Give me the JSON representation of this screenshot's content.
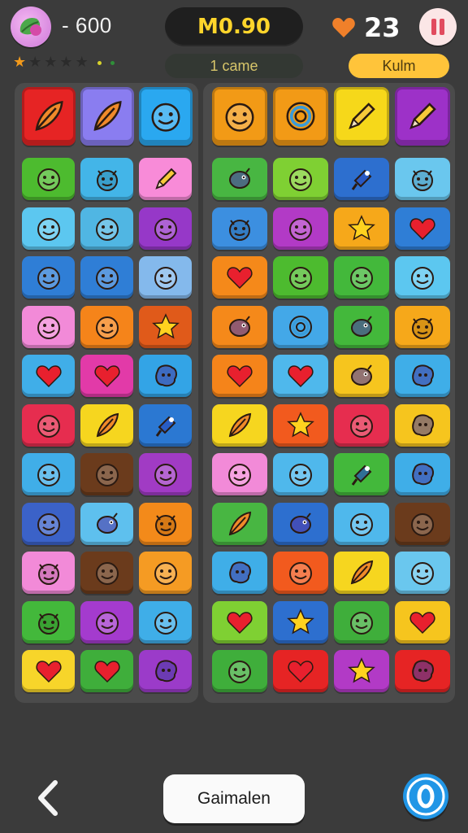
{
  "hud": {
    "coins": "- 600",
    "score": "M0.90",
    "subtitle": "1 came",
    "lives": "23",
    "mode": "Kulm"
  },
  "rating": {
    "stars": [
      {
        "color": "#f39a1b"
      },
      {
        "color": "#2b2b2b"
      },
      {
        "color": "#2b2b2b"
      },
      {
        "color": "#2b2b2b"
      },
      {
        "color": "#2b2b2b"
      }
    ],
    "dots": [
      "#d7d22b",
      "#2f8f39"
    ]
  },
  "footer": {
    "main_button": "Gaimalen"
  },
  "colors": {
    "background": "#3b3b3b",
    "board": "#4b4b4b",
    "score_text": "#ffd52b",
    "mode_pill": "#ffc43a",
    "help_button": "#2196e6"
  },
  "left_board": {
    "rows": [
      [
        {
          "color": "#e62424",
          "icon": "feather"
        },
        {
          "color": "#8a7df0",
          "icon": "feather"
        },
        {
          "color": "#2aa8f0",
          "icon": "face"
        }
      ],
      [
        {
          "color": "#4dbb2f",
          "icon": "face"
        },
        {
          "color": "#43b5e8",
          "icon": "devil"
        },
        {
          "color": "#f88bd8",
          "icon": "pencil"
        }
      ],
      [
        {
          "color": "#5cc7f0",
          "icon": "face"
        },
        {
          "color": "#50b6e3",
          "icon": "face"
        },
        {
          "color": "#9638c8",
          "icon": "face"
        }
      ],
      [
        {
          "color": "#2f7ed6",
          "icon": "face"
        },
        {
          "color": "#2f7ed6",
          "icon": "face"
        },
        {
          "color": "#84b9ec",
          "icon": "face"
        }
      ],
      [
        {
          "color": "#f28ad8",
          "icon": "face"
        },
        {
          "color": "#f5841a",
          "icon": "face"
        },
        {
          "color": "#e05a1a",
          "icon": "star"
        }
      ],
      [
        {
          "color": "#40aee8",
          "icon": "heart"
        },
        {
          "color": "#e23aa8",
          "icon": "heart"
        },
        {
          "color": "#33a4e6",
          "icon": "blob"
        }
      ],
      [
        {
          "color": "#e62d4f",
          "icon": "face"
        },
        {
          "color": "#f6d61f",
          "icon": "feather"
        },
        {
          "color": "#2b78d2",
          "icon": "pin"
        }
      ],
      [
        {
          "color": "#40aee8",
          "icon": "face"
        },
        {
          "color": "#6b3b1c",
          "icon": "face"
        },
        {
          "color": "#a13bc4",
          "icon": "face"
        }
      ],
      [
        {
          "color": "#3b62c8",
          "icon": "face"
        },
        {
          "color": "#5ec0ee",
          "icon": "bug"
        },
        {
          "color": "#f38a1a",
          "icon": "devil"
        }
      ],
      [
        {
          "color": "#f28ad8",
          "icon": "devil"
        },
        {
          "color": "#6b3b1c",
          "icon": "face"
        },
        {
          "color": "#f59b23",
          "icon": "face"
        }
      ],
      [
        {
          "color": "#43b83b",
          "icon": "devil"
        },
        {
          "color": "#a43bce",
          "icon": "face"
        },
        {
          "color": "#3faee8",
          "icon": "face"
        }
      ],
      [
        {
          "color": "#f7d52a",
          "icon": "heart"
        },
        {
          "color": "#3fae3b",
          "icon": "heart"
        },
        {
          "color": "#9b3bc9",
          "icon": "blob"
        }
      ]
    ]
  },
  "right_board": {
    "rows": [
      [
        {
          "color": "#f29a16",
          "icon": "face"
        },
        {
          "color": "#f29a16",
          "icon": "ring"
        },
        {
          "color": "#f6d81a",
          "icon": "pencil"
        },
        {
          "color": "#9d31c8",
          "icon": "pencil"
        }
      ],
      [
        {
          "color": "#48b642",
          "icon": "bug"
        },
        {
          "color": "#7fd033",
          "icon": "face"
        },
        {
          "color": "#2d6fcf",
          "icon": "pin"
        },
        {
          "color": "#6ac7ee",
          "icon": "devil"
        }
      ],
      [
        {
          "color": "#3c8fe0",
          "icon": "devil"
        },
        {
          "color": "#b23ac6",
          "icon": "face"
        },
        {
          "color": "#f6a81a",
          "icon": "star"
        },
        {
          "color": "#2f7ed6",
          "icon": "heart"
        }
      ],
      [
        {
          "color": "#f5891a",
          "icon": "heart"
        },
        {
          "color": "#4dbb2f",
          "icon": "face"
        },
        {
          "color": "#43b83b",
          "icon": "face"
        },
        {
          "color": "#5cc7f0",
          "icon": "face"
        }
      ],
      [
        {
          "color": "#f5891a",
          "icon": "bug"
        },
        {
          "color": "#43a8e8",
          "icon": "ring"
        },
        {
          "color": "#43b83b",
          "icon": "bug"
        },
        {
          "color": "#f6a81a",
          "icon": "devil"
        }
      ],
      [
        {
          "color": "#f5841a",
          "icon": "heart"
        },
        {
          "color": "#4fb8ec",
          "icon": "heart"
        },
        {
          "color": "#f6c51e",
          "icon": "bug"
        },
        {
          "color": "#3faee8",
          "icon": "blob"
        }
      ],
      [
        {
          "color": "#f6d61f",
          "icon": "feather"
        },
        {
          "color": "#f25a1e",
          "icon": "star"
        },
        {
          "color": "#e62d4f",
          "icon": "face"
        },
        {
          "color": "#f6c51e",
          "icon": "blob"
        }
      ],
      [
        {
          "color": "#f28ad8",
          "icon": "face"
        },
        {
          "color": "#4fb8ec",
          "icon": "face"
        },
        {
          "color": "#43b83b",
          "icon": "pin"
        },
        {
          "color": "#3faee8",
          "icon": "blob"
        }
      ],
      [
        {
          "color": "#48b642",
          "icon": "feather"
        },
        {
          "color": "#2d6fcf",
          "icon": "bug"
        },
        {
          "color": "#4fb8ec",
          "icon": "face"
        },
        {
          "color": "#6b3b1c",
          "icon": "face"
        }
      ],
      [
        {
          "color": "#3faee8",
          "icon": "blob"
        },
        {
          "color": "#f25a1e",
          "icon": "face"
        },
        {
          "color": "#f6d61f",
          "icon": "feather"
        },
        {
          "color": "#6ac7ee",
          "icon": "face"
        }
      ],
      [
        {
          "color": "#7fd033",
          "icon": "heart"
        },
        {
          "color": "#2d6fcf",
          "icon": "star"
        },
        {
          "color": "#3fae3b",
          "icon": "face"
        },
        {
          "color": "#f6c51e",
          "icon": "heart"
        }
      ],
      [
        {
          "color": "#3fae3b",
          "icon": "face"
        },
        {
          "color": "#e62424",
          "icon": "heart"
        },
        {
          "color": "#b23ac6",
          "icon": "star"
        },
        {
          "color": "#e62424",
          "icon": "blob"
        }
      ]
    ]
  }
}
